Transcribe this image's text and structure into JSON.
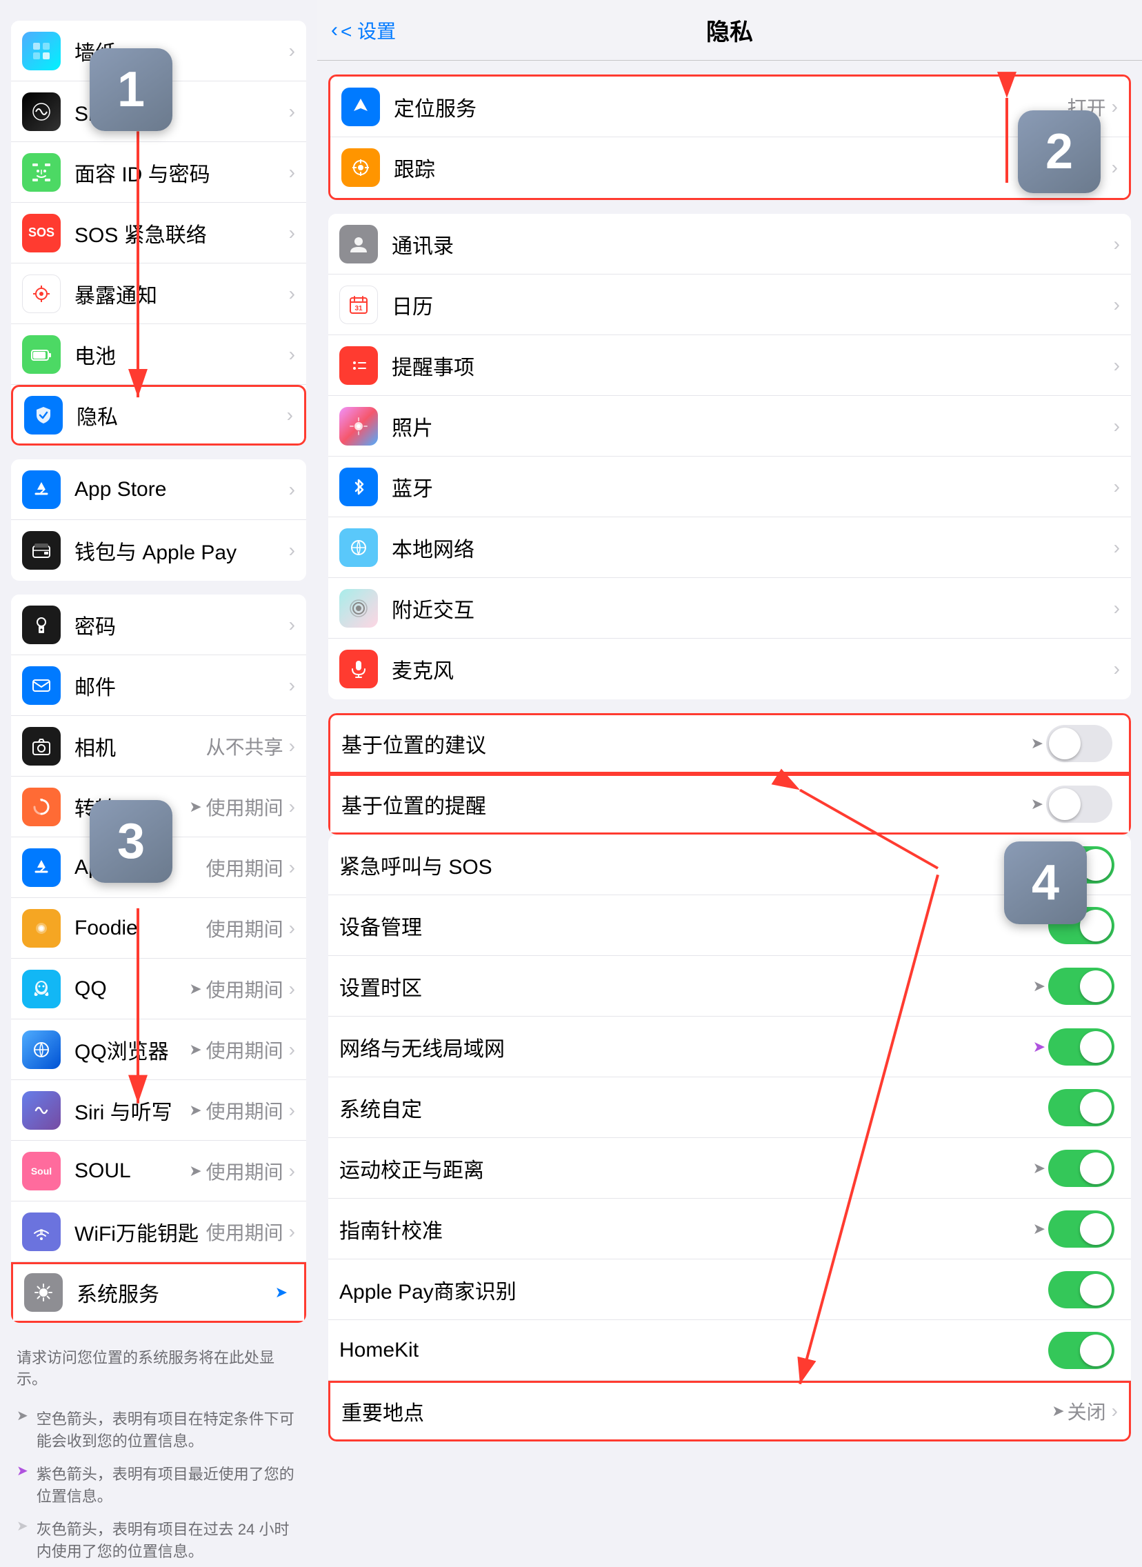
{
  "left": {
    "items_top": [
      {
        "id": "wallpaper",
        "icon_class": "icon-wallpaper",
        "icon_text": "⚙",
        "label": "墙纸",
        "value": "",
        "has_chevron": true
      },
      {
        "id": "siri",
        "icon_class": "icon-siri",
        "icon_text": "◉",
        "label": "Siri 与搜索",
        "value": "",
        "has_chevron": true
      },
      {
        "id": "faceid",
        "icon_class": "icon-faceid",
        "icon_text": "😊",
        "label": "面容 ID 与密码",
        "value": "",
        "has_chevron": true
      },
      {
        "id": "sos",
        "icon_class": "icon-sos",
        "icon_text": "SOS",
        "label": "SOS 紧急联络",
        "value": "",
        "has_chevron": true
      },
      {
        "id": "exposure",
        "icon_class": "icon-exposure",
        "icon_text": "⊙",
        "label": "暴露通知",
        "value": "",
        "has_chevron": true
      },
      {
        "id": "battery",
        "icon_class": "icon-battery",
        "icon_text": "▬",
        "label": "电池",
        "value": "",
        "has_chevron": true
      },
      {
        "id": "privacy",
        "icon_class": "icon-privacy",
        "icon_text": "✋",
        "label": "隐私",
        "value": "",
        "has_chevron": true,
        "highlighted": true
      }
    ],
    "items_group2": [
      {
        "id": "appstore2",
        "icon_class": "icon-appstore",
        "icon_text": "A",
        "label": "App Store",
        "value": "",
        "has_chevron": true
      },
      {
        "id": "wallet",
        "icon_class": "icon-wallet",
        "icon_text": "💳",
        "label": "钱包与 Apple Pay",
        "value": "",
        "has_chevron": true
      }
    ],
    "items_group3_label": "请求访问您位置的系统服务将在此处显示。",
    "items_group3": [
      {
        "id": "password",
        "icon_class": "icon-password",
        "icon_text": "🔑",
        "label": "密码",
        "value": "",
        "has_chevron": true
      },
      {
        "id": "mail",
        "icon_class": "icon-mail",
        "icon_text": "✉",
        "label": "邮件",
        "value": "",
        "has_chevron": true
      },
      {
        "id": "camera",
        "icon_class": "icon-camera",
        "icon_text": "📷",
        "label": "相机",
        "value": "从不共享",
        "has_chevron": true
      },
      {
        "id": "zhuanzhuan",
        "icon_class": "icon-zhuanzhuan",
        "icon_text": "♻",
        "label": "转转",
        "value": "使用期间",
        "has_loc": true,
        "has_chevron": true
      },
      {
        "id": "appstore3",
        "icon_class": "icon-appstore",
        "icon_text": "A",
        "label": "App Store",
        "value": "使用期间",
        "has_chevron": true
      },
      {
        "id": "foodie",
        "icon_class": "icon-foodie",
        "icon_text": "🍴",
        "label": "Foodie",
        "value": "使用期间",
        "has_chevron": true
      },
      {
        "id": "qq",
        "icon_class": "icon-qq",
        "icon_text": "🐧",
        "label": "QQ",
        "value": "使用期间",
        "has_loc": true,
        "has_chevron": true
      },
      {
        "id": "qqbrowser",
        "icon_class": "icon-qqbrowser",
        "icon_text": "Q",
        "label": "QQ浏览器",
        "value": "使用期间",
        "has_loc": true,
        "has_chevron": true
      },
      {
        "id": "siriapp",
        "icon_class": "icon-siriapp",
        "icon_text": "◈",
        "label": "Siri 与听写",
        "value": "使用期间",
        "has_loc": true,
        "has_chevron": true
      },
      {
        "id": "soul",
        "icon_class": "icon-soul",
        "icon_text": "Soul",
        "label": "SOUL",
        "value": "使用期间",
        "has_loc": true,
        "has_chevron": true
      },
      {
        "id": "wifi",
        "icon_class": "icon-wifi",
        "icon_text": "📶",
        "label": "WiFi万能钥匙",
        "value": "使用期间",
        "has_chevron": true
      },
      {
        "id": "system",
        "icon_class": "icon-system",
        "icon_text": "⚙",
        "label": "系统服务",
        "value": "",
        "has_loc_blue": true,
        "has_chevron": false,
        "highlighted": true
      }
    ],
    "info_text": "请求访问您位置的系统服务将在此处显示。",
    "legend1": "空色箭头，表明有项目在特定条件下可能会收到您的位置信息。",
    "legend2": "紫色箭头，表明有项目最近使用了您的位置信息。",
    "legend3": "灰色箭头，表明有项目在过去 24 小时内使用了您的位置信息。"
  },
  "right": {
    "nav_back": "< 设置",
    "nav_title": "隐私",
    "items_top": [
      {
        "id": "location",
        "icon_class": "icon-location",
        "icon_text": "➤",
        "label": "定位服务",
        "value": "打开",
        "has_chevron": true,
        "highlighted": true
      },
      {
        "id": "tracking",
        "icon_class": "icon-tracking",
        "icon_text": "⊙",
        "label": "跟踪",
        "value": "",
        "has_chevron": true
      }
    ],
    "items_permissions": [
      {
        "id": "contacts",
        "icon_class": "icon-contacts",
        "icon_text": "👤",
        "label": "通讯录",
        "value": "",
        "has_chevron": true
      },
      {
        "id": "calendar",
        "icon_class": "icon-calendar",
        "icon_text": "📅",
        "label": "日历",
        "value": "",
        "has_chevron": true
      },
      {
        "id": "reminders",
        "icon_class": "icon-reminders",
        "icon_text": "•••",
        "label": "提醒事项",
        "value": "",
        "has_chevron": true
      },
      {
        "id": "photos",
        "icon_class": "icon-photos",
        "icon_text": "🌸",
        "label": "照片",
        "value": "",
        "has_chevron": true
      },
      {
        "id": "bluetooth",
        "icon_class": "icon-bluetooth",
        "icon_text": "✦",
        "label": "蓝牙",
        "value": "",
        "has_chevron": true
      },
      {
        "id": "network",
        "icon_class": "icon-network",
        "icon_text": "🌐",
        "label": "本地网络",
        "value": "",
        "has_chevron": true
      },
      {
        "id": "nearby",
        "icon_class": "icon-nearby",
        "icon_text": "◎",
        "label": "附近交互",
        "value": "",
        "has_chevron": true
      },
      {
        "id": "mic",
        "icon_class": "icon-mic",
        "icon_text": "🎤",
        "label": "麦克风",
        "value": "",
        "has_chevron": true
      }
    ],
    "location_services": [
      {
        "id": "loc_suggest",
        "label": "基于位置的建议",
        "toggle": "off",
        "has_loc": true,
        "highlighted": true
      },
      {
        "id": "loc_remind",
        "label": "基于位置的提醒",
        "toggle": "off",
        "has_loc": true,
        "highlighted": true
      },
      {
        "id": "emergency",
        "label": "紧急呼叫与 SOS",
        "toggle": "on"
      },
      {
        "id": "device_mgmt",
        "label": "设备管理",
        "toggle": "on"
      },
      {
        "id": "timezone",
        "label": "设置时区",
        "toggle": "on",
        "has_loc": true
      },
      {
        "id": "network_wireless",
        "label": "网络与无线局域网",
        "toggle": "on",
        "has_loc_purple": true
      },
      {
        "id": "system_custom",
        "label": "系统自定",
        "toggle": "on"
      },
      {
        "id": "motion",
        "label": "运动校正与距离",
        "toggle": "on",
        "has_loc": true
      },
      {
        "id": "compass",
        "label": "指南针校准",
        "toggle": "on",
        "has_loc": true
      },
      {
        "id": "applepay",
        "label": "Apple Pay商家识别",
        "toggle": "on"
      },
      {
        "id": "homekit",
        "label": "HomeKit",
        "toggle": "on"
      },
      {
        "id": "important_places",
        "label": "重要地点",
        "value": "关闭",
        "has_chevron": true,
        "has_loc": true,
        "highlighted": true
      }
    ]
  },
  "step1": "1",
  "step2": "2",
  "step3": "3",
  "step4": "4"
}
